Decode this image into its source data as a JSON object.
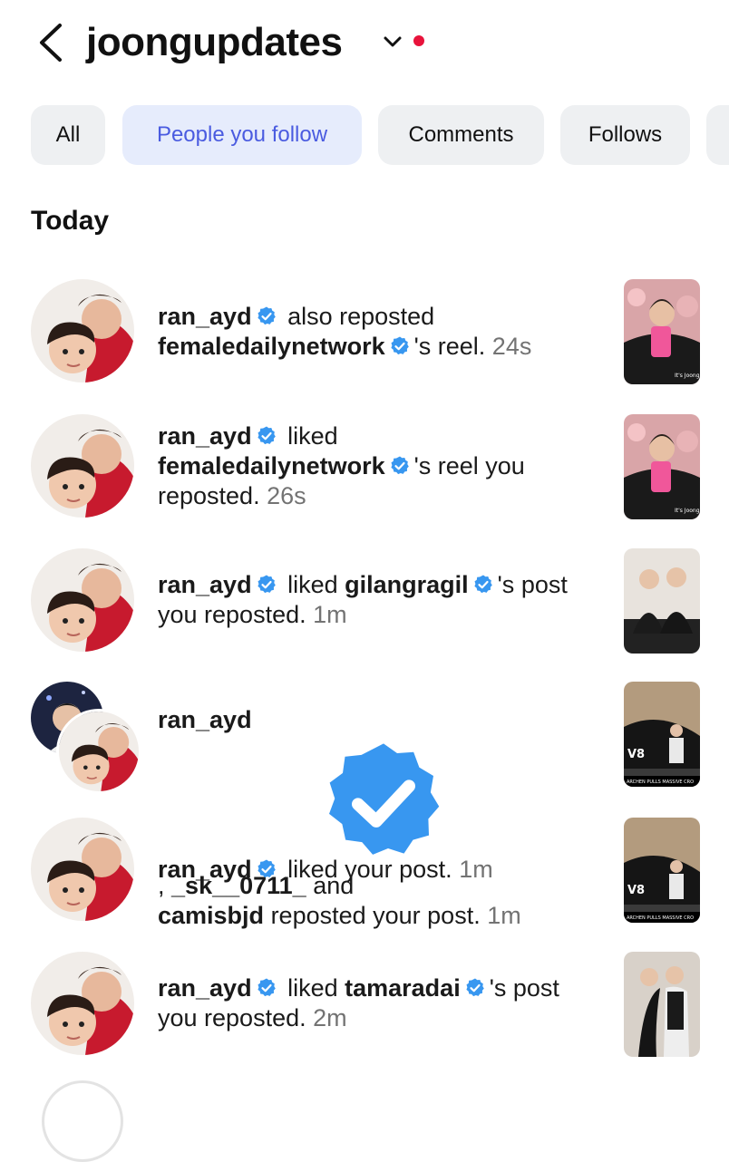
{
  "header": {
    "title": "joongupdates",
    "icons": {
      "back": "chevron-left-icon",
      "menu": "chevron-down-icon",
      "notification": "red-dot"
    },
    "dot_color": "#e8133b"
  },
  "filters": {
    "chips": [
      {
        "label": "All",
        "active": false
      },
      {
        "label": "People you follow",
        "active": true
      },
      {
        "label": "Comments",
        "active": false
      },
      {
        "label": "Follows",
        "active": false
      }
    ],
    "active_color": "#4a5be0"
  },
  "section": {
    "title": "Today"
  },
  "notifications": [
    {
      "user": "ran_ayd",
      "verified": true,
      "text_parts": {
        "a": "also reposted",
        "b": "femaledailynetwork",
        "c": "'s reel.",
        "time": "24s"
      },
      "thumb": "reel-thumbnail"
    },
    {
      "user": "ran_ayd",
      "verified": true,
      "text_parts": {
        "a": "liked",
        "b": "femaledailynetwork",
        "c": "'s reel you reposted.",
        "time": "26s"
      },
      "thumb": "reel-thumbnail"
    },
    {
      "user": "ran_ayd",
      "verified": true,
      "text_parts": {
        "a": "liked",
        "b": "gilangragil",
        "c": "'s post you reposted.",
        "time": "1m"
      },
      "thumb": "post-thumbnail"
    },
    {
      "user": "ran_ayd",
      "verified": true,
      "text_parts": {
        "a": ",",
        "b": "_sk__0711_",
        "c": "and",
        "d": "camisbjd",
        "e": "reposted your post.",
        "time": "1m"
      },
      "thumb": "post-thumbnail"
    },
    {
      "user": "ran_ayd",
      "verified": true,
      "text_parts": {
        "a": "liked your post.",
        "time": "1m"
      },
      "thumb": "post-thumbnail"
    },
    {
      "user": "ran_ayd",
      "verified": true,
      "text_parts": {
        "a": "liked",
        "b": "tamaradai",
        "c": "'s post you reposted.",
        "time": "2m"
      },
      "thumb": "post-thumbnail"
    }
  ],
  "colors": {
    "verified": "#3897f0",
    "muted_text": "#737373"
  }
}
